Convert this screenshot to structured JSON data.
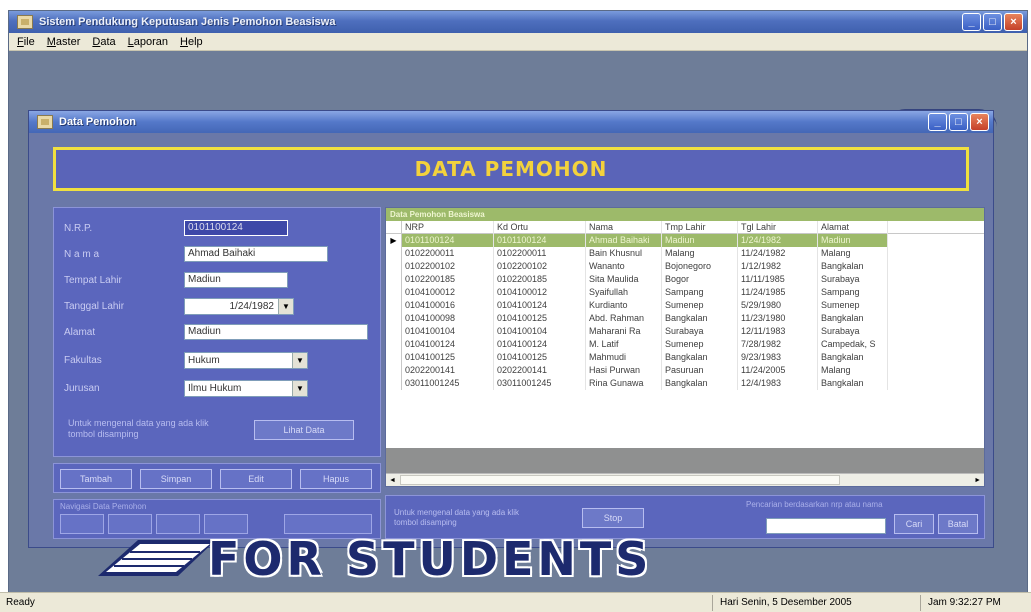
{
  "app": {
    "title": "Sistem Pendukung Keputusan Jenis Pemohon Beasiswa",
    "menu": [
      "File",
      "Master",
      "Data",
      "Laporan",
      "Help"
    ]
  },
  "dialog": {
    "title": "Data Pemohon",
    "banner": "DATA PEMOHON"
  },
  "form": {
    "fields": [
      {
        "label": "N.R.P.",
        "value": "0101100124"
      },
      {
        "label": "N a m a",
        "value": "Ahmad Baihaki"
      },
      {
        "label": "Tempat Lahir",
        "value": "Madiun"
      },
      {
        "label": "Tanggal Lahir",
        "value": "1/24/1982"
      },
      {
        "label": "Alamat",
        "value": "Madiun"
      },
      {
        "label": "Fakultas",
        "value": "Hukum"
      },
      {
        "label": "Jurusan",
        "value": "Ilmu Hukum"
      }
    ],
    "note": "Untuk mengenal data yang ada klik tombol disamping",
    "view_button": "Lihat Data"
  },
  "actions": {
    "buttons": [
      "Tambah",
      "Simpan",
      "Edit",
      "Hapus"
    ]
  },
  "navigator": {
    "title": "Navigasi Data Pemohon"
  },
  "grid": {
    "caption": "Data Pemohon Beasiswa",
    "columns": [
      "NRP",
      "Kd Ortu",
      "Nama",
      "Tmp Lahir",
      "Tgl Lahir",
      "Alamat"
    ],
    "rows": [
      [
        "0101100124",
        "0101100124",
        "Ahmad Baihaki",
        "Madiun",
        "1/24/1982",
        "Madiun"
      ],
      [
        "0102200011",
        "0102200011",
        "Bain Khusnul",
        "Malang",
        "11/24/1982",
        "Malang"
      ],
      [
        "0102200102",
        "0102200102",
        "Wananto",
        "Bojonegoro",
        "1/12/1982",
        "Bangkalan"
      ],
      [
        "0102200185",
        "0102200185",
        "Sita Maulida",
        "Bogor",
        "11/11/1985",
        "Surabaya"
      ],
      [
        "0104100012",
        "0104100012",
        "Syaifullah",
        "Sampang",
        "11/24/1985",
        "Sampang"
      ],
      [
        "0104100016",
        "0104100124",
        "Kurdianto",
        "Sumenep",
        "5/29/1980",
        "Sumenep"
      ],
      [
        "0104100098",
        "0104100125",
        "Abd. Rahman",
        "Bangkalan",
        "11/23/1980",
        "Bangkalan"
      ],
      [
        "0104100104",
        "0104100104",
        "Maharani Ra",
        "Surabaya",
        "12/11/1983",
        "Surabaya"
      ],
      [
        "0104100124",
        "0104100124",
        "M. Latif",
        "Sumenep",
        "7/28/1982",
        "Campedak, S"
      ],
      [
        "0104100125",
        "0104100125",
        "Mahmudi",
        "Bangkalan",
        "9/23/1983",
        "Bangkalan"
      ],
      [
        "0202200141",
        "0202200141",
        "Hasi Purwan",
        "Pasuruan",
        "11/24/2005",
        "Malang"
      ],
      [
        "03011001245",
        "03011001245",
        "Rina Gunawa",
        "Bangkalan",
        "12/4/1983",
        "Bangkalan"
      ]
    ],
    "selected_index": 0
  },
  "bottom": {
    "note": "Untuk mengenal data yang ada klik tombol disamping",
    "stop_button": "Stop",
    "search_label": "Pencarian berdasarkan nrp atau nama",
    "search_value": "",
    "cari_button": "Cari",
    "batal_button": "Batal"
  },
  "watermark": "FOR STUDENTS",
  "status": {
    "left": "Ready",
    "date": "Hari Senin, 5 Desember 2005",
    "time": "Jam 9:32:27 PM"
  }
}
